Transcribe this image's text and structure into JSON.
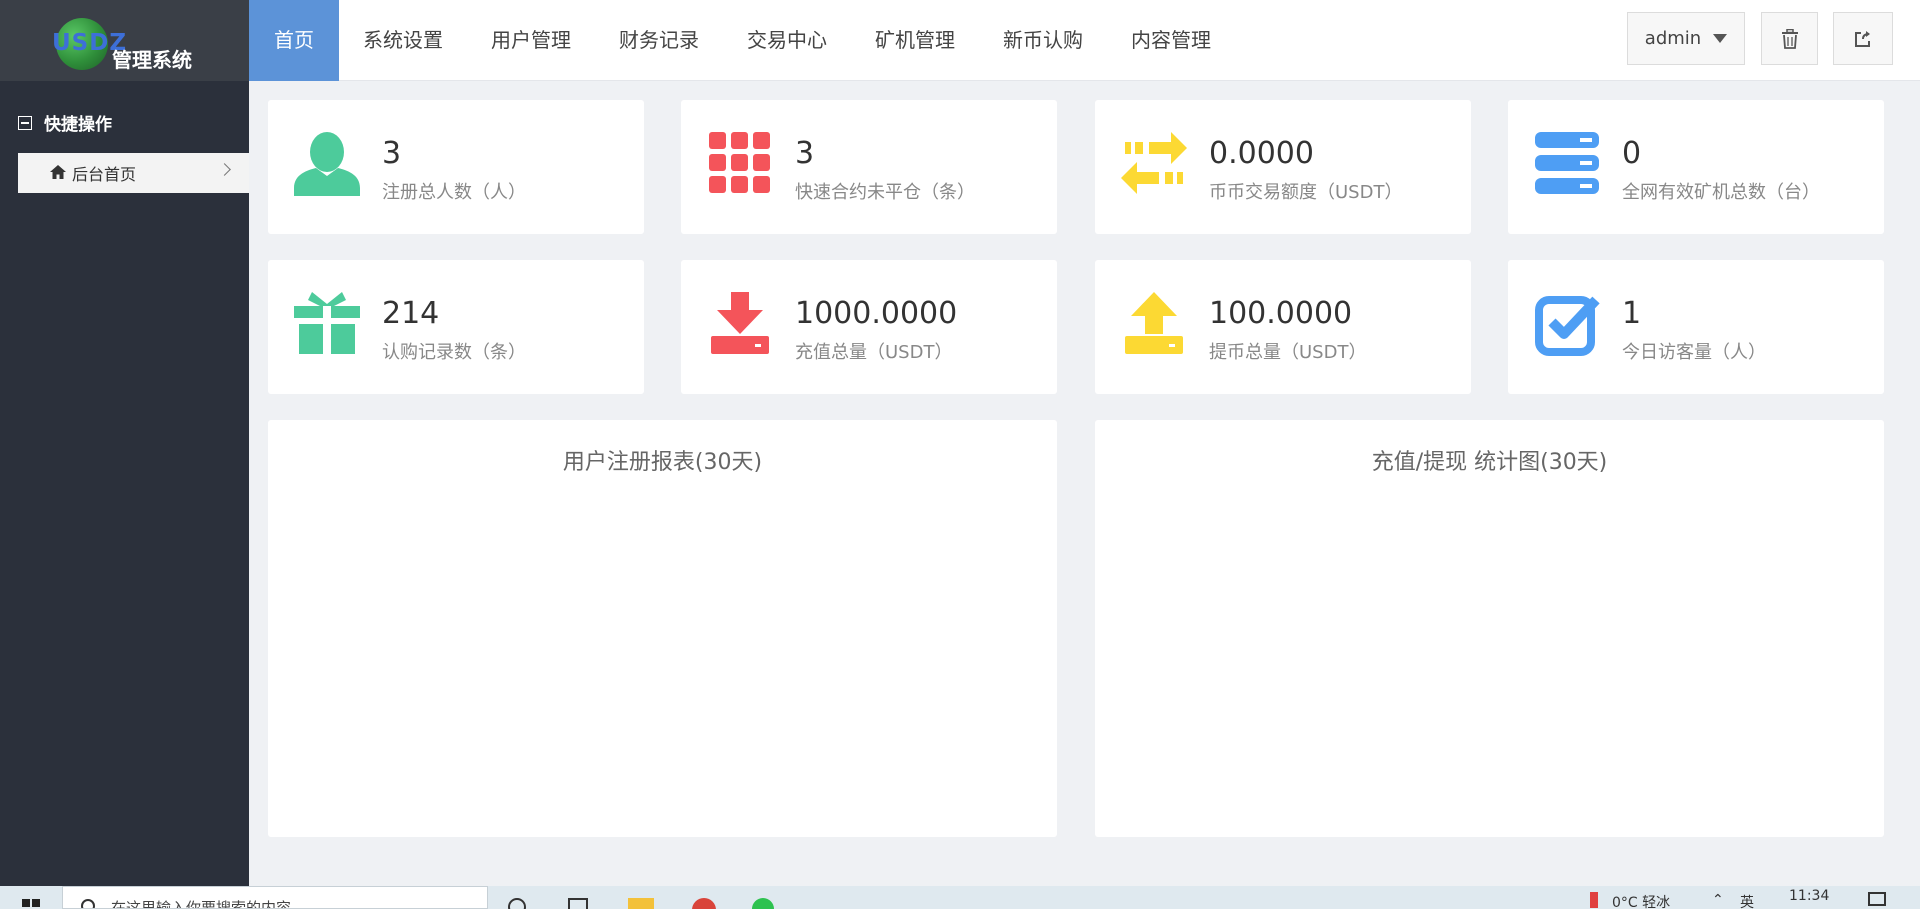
{
  "app": {
    "logo_text": "USDZ",
    "title": "管理系统"
  },
  "sidebar": {
    "group_label": "快捷操作",
    "items": [
      {
        "label": "后台首页",
        "icon": "home-icon"
      }
    ]
  },
  "nav": {
    "items": [
      {
        "label": "首页",
        "active": true
      },
      {
        "label": "系统设置"
      },
      {
        "label": "用户管理"
      },
      {
        "label": "财务记录"
      },
      {
        "label": "交易中心"
      },
      {
        "label": "矿机管理"
      },
      {
        "label": "新币认购"
      },
      {
        "label": "内容管理"
      }
    ],
    "user": "admin"
  },
  "stats": [
    {
      "value": "3",
      "label": "注册总人数（人）",
      "icon": "user-icon",
      "color": "#4dcb9b"
    },
    {
      "value": "3",
      "label": "快速合约未平仓（条）",
      "icon": "grid-icon",
      "color": "#f4545a"
    },
    {
      "value": "0.0000",
      "label": "币币交易额度（USDT）",
      "icon": "exchange-icon",
      "color": "#fcd933"
    },
    {
      "value": "0",
      "label": "全网有效矿机总数（台）",
      "icon": "server-icon",
      "color": "#4e9ef4"
    },
    {
      "value": "214",
      "label": "认购记录数（条）",
      "icon": "gift-icon",
      "color": "#4dcb9b"
    },
    {
      "value": "1000.0000",
      "label": "充值总量（USDT）",
      "icon": "download-icon",
      "color": "#f4545a"
    },
    {
      "value": "100.0000",
      "label": "提币总量（USDT）",
      "icon": "upload-icon",
      "color": "#fcd933"
    },
    {
      "value": "1",
      "label": "今日访客量（人）",
      "icon": "check-icon",
      "color": "#4e9ef4"
    }
  ],
  "panels": [
    {
      "title": "用户注册报表(30天)"
    },
    {
      "title": "充值/提现 统计图(30天)"
    }
  ],
  "taskbar": {
    "search_placeholder": "在这里输入你要搜索的内容",
    "weather": "0°C  轻冰",
    "lang": "英",
    "time": "11:34"
  }
}
